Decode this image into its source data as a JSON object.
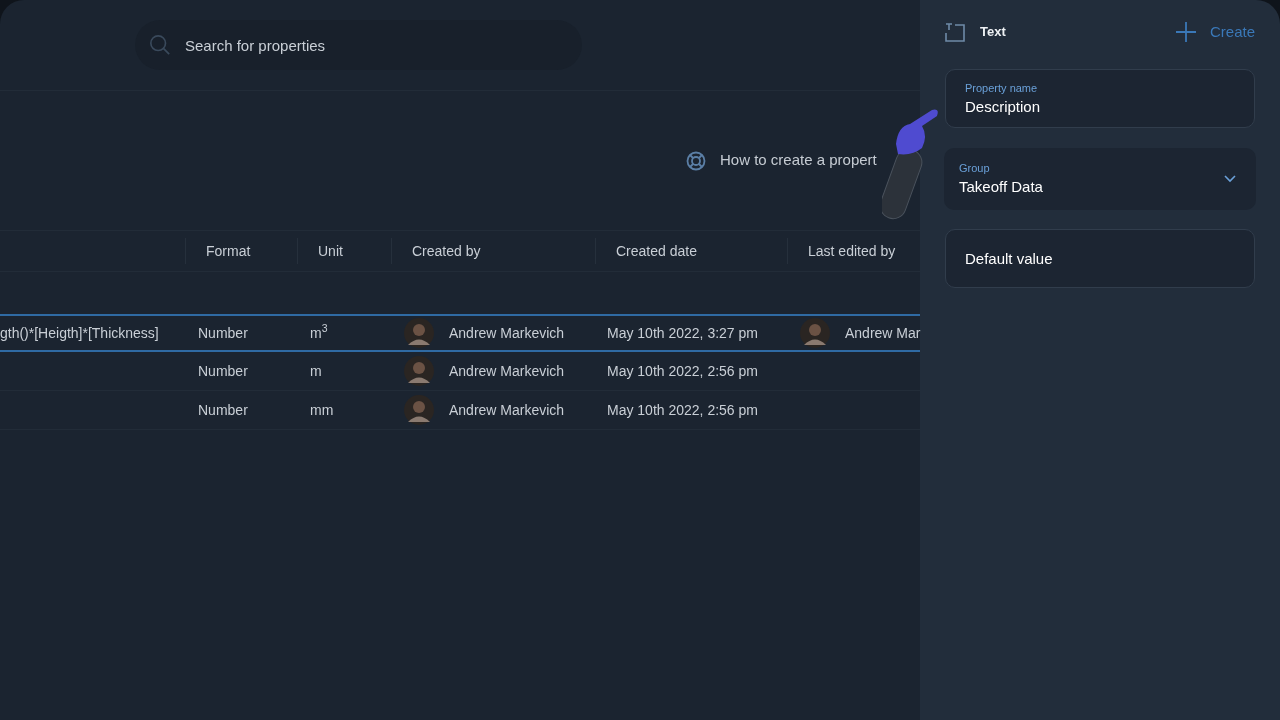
{
  "search": {
    "placeholder": "Search for properties"
  },
  "help_link": "How to create a propert",
  "table": {
    "columns": [
      "Format",
      "Unit",
      "Created by",
      "Created date",
      "Last edited by"
    ],
    "rows": [
      {
        "selected": true,
        "column_1": "gth()*[Heigth]*[Thickness]",
        "format": "Number",
        "unit": "m$^{3}$",
        "created_by": "Andrew Markevich",
        "created_date": "May 10th 2022, 3:27 pm",
        "last_edited_by": "Andrew Mar"
      },
      {
        "selected": false,
        "format": "Number",
        "unit": "m",
        "created_by": "Andrew Markevich",
        "created_date": "May 10th 2022, 2:56 pm"
      },
      {
        "selected": false,
        "format": "Number",
        "unit": "mm",
        "created_by": "Andrew Markevich",
        "created_date": "May 10th 2022, 2:56 pm"
      }
    ]
  },
  "panel": {
    "type_label": "Text",
    "create_button": "Create",
    "property_name": {
      "label": "Property name",
      "value": "Description"
    },
    "group": {
      "label": "Group",
      "value": "Takeoff Data"
    },
    "default_value": {
      "placeholder": "Default value"
    }
  }
}
